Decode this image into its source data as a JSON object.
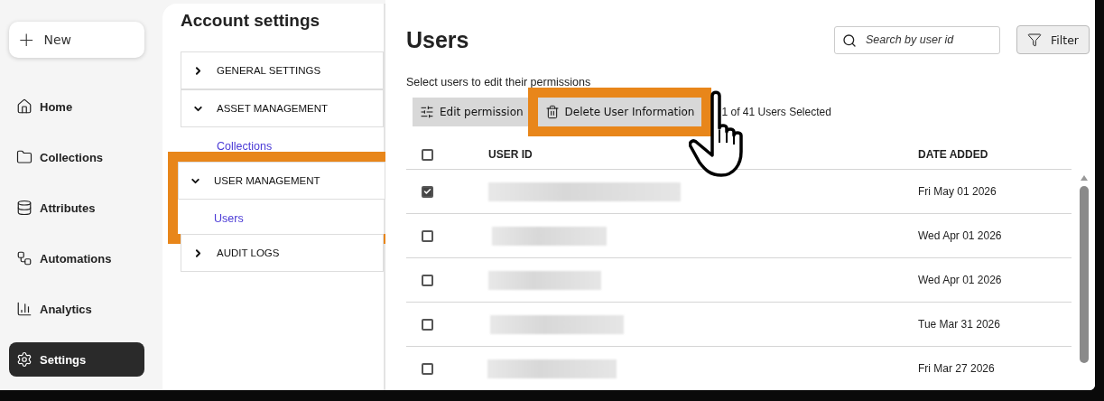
{
  "sidebar": {
    "new_button": {
      "icon": "+",
      "label": "New"
    },
    "items": [
      {
        "kind": "home",
        "label": "Home",
        "selected": false
      },
      {
        "kind": "folder",
        "label": "Collections",
        "selected": false
      },
      {
        "kind": "database",
        "label": "Attributes",
        "selected": false
      },
      {
        "kind": "automation",
        "label": "Automations",
        "selected": false
      },
      {
        "kind": "chart",
        "label": "Analytics",
        "selected": false
      },
      {
        "kind": "gear",
        "label": "Settings",
        "selected": true
      }
    ]
  },
  "settings_panel": {
    "title": "Account settings",
    "sections": [
      {
        "label": "GENERAL SETTINGS",
        "expanded": false,
        "highlighted": false
      },
      {
        "label": "ASSET MANAGEMENT",
        "expanded": true,
        "highlighted": false,
        "children": [
          {
            "label": "Collections"
          }
        ]
      },
      {
        "label": "USER MANAGEMENT",
        "expanded": true,
        "highlighted": true,
        "children": [
          {
            "label": "Users"
          }
        ]
      },
      {
        "label": "AUDIT LOGS",
        "expanded": false,
        "highlighted": false
      }
    ]
  },
  "main": {
    "title": "Users",
    "search": {
      "placeholder": "Search by user id"
    },
    "filter_button": "Filter",
    "subtitle": "Select users to edit their permissions",
    "actions": [
      {
        "kind": "sliders",
        "label": "Edit permission",
        "highlighted": false
      },
      {
        "kind": "trash",
        "label": "Delete User Information",
        "highlighted": true
      }
    ],
    "selection_count": "1 of 41 Users Selected",
    "table": {
      "select_all": {
        "checked": false
      },
      "columns": [
        "USER ID",
        "DATE ADDED"
      ],
      "rows": [
        {
          "checked": true,
          "user_id": {
            "kind": "redacted"
          },
          "date_added": "Fri May 01 2026"
        },
        {
          "checked": false,
          "user_id": {
            "kind": "redacted"
          },
          "date_added": "Wed Apr 01 2026"
        },
        {
          "checked": false,
          "user_id": {
            "kind": "redacted"
          },
          "date_added": "Wed Apr 01 2026"
        },
        {
          "checked": false,
          "user_id": {
            "kind": "redacted"
          },
          "date_added": "Tue Mar 31 2026"
        },
        {
          "checked": false,
          "user_id": {
            "kind": "redacted"
          },
          "date_added": "Fri Mar 27 2026"
        }
      ]
    }
  }
}
